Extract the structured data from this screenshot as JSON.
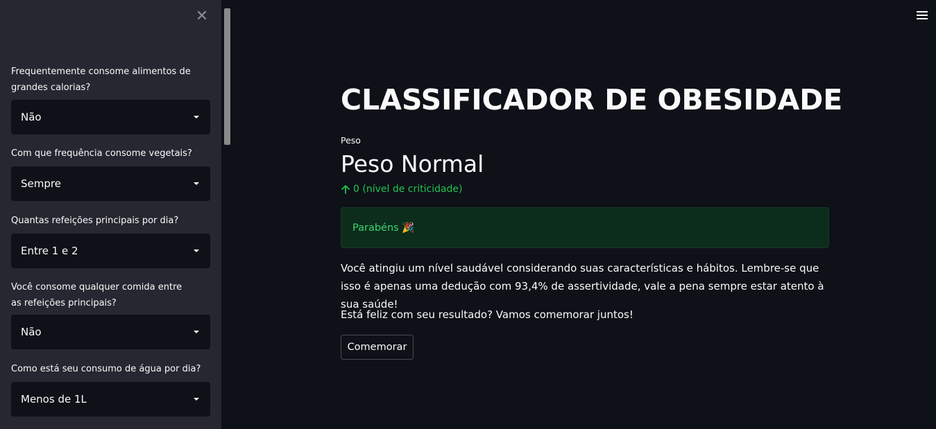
{
  "sidebar": {
    "fields": [
      {
        "label": "Frequentemente consome alimentos de grandes calorias?",
        "value": "Não"
      },
      {
        "label": "Com que frequência consome vegetais?",
        "value": "Sempre"
      },
      {
        "label": "Quantas refeições principais por dia?",
        "value": "Entre 1 e 2"
      },
      {
        "label": "Você consome qualquer comida entre as refeições principais?",
        "value": "Não"
      },
      {
        "label": "Como está seu consumo de água por dia?",
        "value": "Menos de 1L"
      }
    ]
  },
  "main": {
    "title": "CLASSIFICADOR DE OBESIDADE",
    "metric": {
      "label": "Peso",
      "value": "Peso Normal",
      "delta": "0 (nível de criticidade)"
    },
    "success": "Parabéns 🎉",
    "paragraph1": "Você atingiu um nível saudável considerando suas características e hábitos. Lembre-se que isso é apenas uma dedução com 93,4% de assertividade, vale a pena sempre estar atento à sua saúde!",
    "paragraph2": "Está feliz com seu resultado? Vamos comemorar juntos!",
    "button": "Comemorar"
  },
  "icons": {
    "close": "close-icon",
    "menu": "hamburger-menu-icon",
    "delta": "arrow-up-icon",
    "dropdown": "chevron-down-icon"
  },
  "colors": {
    "background": "#0e1117",
    "sidebar": "#262730",
    "success_bg": "#0c2d1c",
    "success_text": "#3dd56d",
    "delta_green": "#21c354"
  }
}
